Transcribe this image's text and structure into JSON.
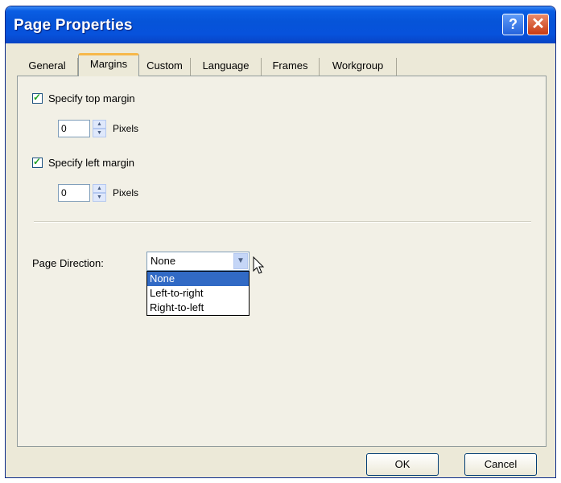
{
  "window": {
    "title": "Page Properties",
    "help_glyph": "?",
    "close_glyph": "✕"
  },
  "tabs": [
    {
      "label": "General",
      "active": false
    },
    {
      "label": "Margins",
      "active": true
    },
    {
      "label": "Custom",
      "active": false
    },
    {
      "label": "Language",
      "active": false
    },
    {
      "label": "Frames",
      "active": false
    },
    {
      "label": "Workgroup",
      "active": false
    }
  ],
  "margins": {
    "top": {
      "checkbox_label": "Specify top margin",
      "checked": true,
      "value": "0",
      "unit": "Pixels"
    },
    "left": {
      "checkbox_label": "Specify left margin",
      "checked": true,
      "value": "0",
      "unit": "Pixels"
    }
  },
  "page_direction": {
    "label": "Page Direction:",
    "selected": "None",
    "options": [
      "None",
      "Left-to-right",
      "Right-to-left"
    ],
    "highlighted_option": "None"
  },
  "buttons": {
    "ok_label": "OK",
    "cancel_label": "Cancel"
  },
  "colors": {
    "titlebar": "#0654d8",
    "dialog_bg": "#ece9d8",
    "selection": "#316ac5",
    "active_tab_accent": "#f7b84a"
  }
}
